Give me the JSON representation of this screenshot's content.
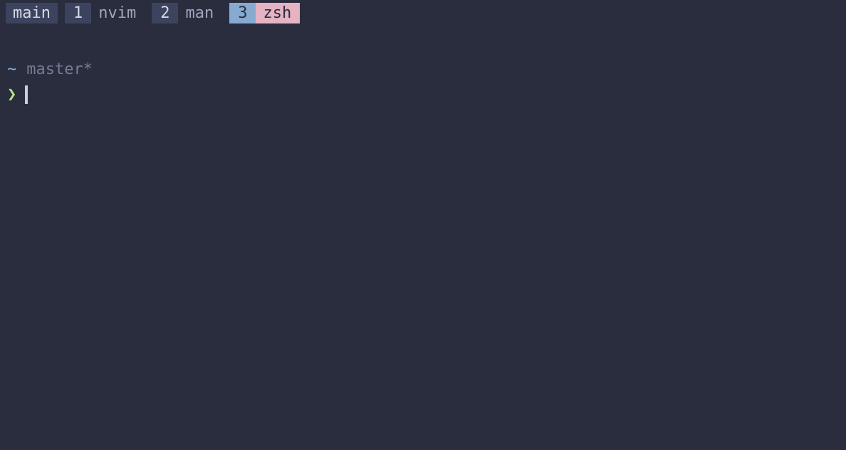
{
  "tabbar": {
    "session": "main",
    "tabs": [
      {
        "num": "1",
        "name": "nvim",
        "active": false
      },
      {
        "num": "2",
        "name": "man",
        "active": false
      },
      {
        "num": "3",
        "name": "zsh",
        "active": true
      }
    ]
  },
  "prompt": {
    "cwd_symbol": "~",
    "branch": "master*",
    "prompt_char": "❯"
  }
}
